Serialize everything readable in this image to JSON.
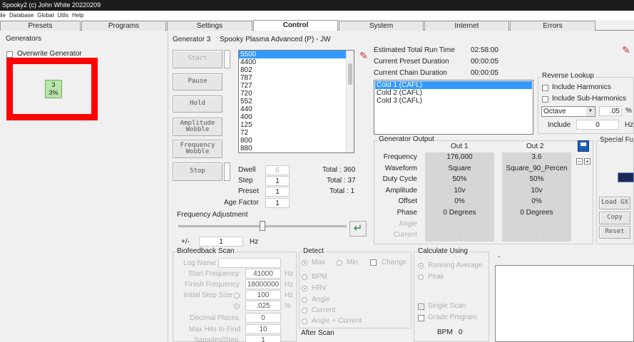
{
  "window": {
    "title": "Spooky2 (c) John White 20220209"
  },
  "menu": [
    "ile",
    "Database",
    "Global",
    "Utils",
    "Help"
  ],
  "tabs": [
    {
      "label": "Presets"
    },
    {
      "label": "Programs"
    },
    {
      "label": "Settings"
    },
    {
      "label": "Control"
    },
    {
      "label": "System"
    },
    {
      "label": "Internet"
    },
    {
      "label": "Errors"
    }
  ],
  "generators": {
    "heading": "Generators",
    "overwrite_label": "Overwrite Generator",
    "tile_number": "3",
    "tile_percent": "3%"
  },
  "control": {
    "gen_label": "Generator 3",
    "gen_program": "Spooky Plasma Advanced (P) - JW",
    "buttons": {
      "start": "Start",
      "pause": "Pause",
      "hold": "Hold",
      "amplitude_wobble": "Amplitude\nWobble",
      "frequency_wobble": "Frequency\nWobble",
      "stop": "Stop"
    },
    "freq_list": [
      "5500",
      "4400",
      "802",
      "787",
      "727",
      "720",
      "552",
      "440",
      "400",
      "125",
      "72",
      "800",
      "880"
    ],
    "dwell_label": "Dwell",
    "dwell_value": "6",
    "step_label": "Step",
    "step_value": "1",
    "preset_label": "Preset",
    "preset_value": "1",
    "age_label": "Age Factor",
    "age_value": "1",
    "total_dwell": "Total : 360",
    "total_step": "Total : 37",
    "total_preset": "Total : 1"
  },
  "run": {
    "estimated_label": "Estimated Total Run Time",
    "estimated_value": "02:58:00",
    "preset_label": "Current Preset Duration",
    "preset_value": "00:00:05",
    "chain_label": "Current Chain Duration",
    "chain_value": "00:00:05",
    "presets": [
      "Cold 1 (CAFL)",
      "Cold 2 (CAFL)",
      "Cold 3 (CAFL)"
    ]
  },
  "reverse_lookup": {
    "heading": "Reverse Lookup",
    "harmonics": "Include Harmonics",
    "sub_harmonics": "Include Sub-Harmonics",
    "mode": "Octave",
    "value": ".05",
    "percent": "%",
    "include_label": "Include",
    "include_value": "0",
    "hz_label": "Hz"
  },
  "special": {
    "heading": "Special Fu",
    "load": "Load GX",
    "copy": "Copy",
    "reset": "Reset"
  },
  "output": {
    "heading": "Generator Output",
    "col1": "Out 1",
    "col2": "Out 2",
    "rows": [
      {
        "label": "Frequency",
        "out1": "176,000",
        "out2": "3.6",
        "dim": false
      },
      {
        "label": "Waveform",
        "out1": "Square",
        "out2": "Square_90_Percen",
        "dim": false
      },
      {
        "label": "Duty Cycle",
        "out1": "50%",
        "out2": "50%",
        "dim": false
      },
      {
        "label": "Amplitude",
        "out1": "10v",
        "out2": "10v",
        "dim": false
      },
      {
        "label": "Offset",
        "out1": "0%",
        "out2": "0%",
        "dim": false
      },
      {
        "label": "Phase",
        "out1": "0 Degrees",
        "out2": "0 Degrees",
        "dim": false
      },
      {
        "label": "Angle",
        "out1": "-",
        "out2": "-",
        "dim": true
      },
      {
        "label": "Current",
        "out1": "-",
        "out2": "-",
        "dim": true
      }
    ]
  },
  "freq_adjust": {
    "heading": "Frequency Adjustment",
    "plusminus": "+/-",
    "value": "1",
    "unit": "Hz",
    "slider_level": 0.5
  },
  "biofeedback": {
    "heading": "Biofeedback Scan",
    "log_name": "Log Name",
    "start_label": "Start Frequency",
    "start_value": "41000",
    "start_unit": "Hz",
    "finish_label": "Finish Frequency",
    "finish_value": "18000000",
    "finish_unit": "Hz",
    "step_label": "Initial Step Size",
    "step_value": "100",
    "step_unit": "Hz",
    "step_pct_value": ".025",
    "step_pct_unit": "%",
    "decimal_label": "Decimal Places",
    "decimal_value": "0",
    "maxhits_label": "Max Hits to Find",
    "maxhits_value": "10",
    "samples_label": "Samples/Step",
    "samples_value": "1"
  },
  "detect": {
    "heading": "Detect",
    "max": "Max",
    "min": "Min",
    "change": "Change",
    "bpm": "BPM",
    "hrv": "HRV",
    "angle": "Angle",
    "current": "Current",
    "angle_current": "Angle + Current",
    "after_scan": "After Scan"
  },
  "calculate": {
    "heading": "Calculate Using",
    "running_average": "Running Average",
    "peak": "Peak",
    "single_scan": "Single Scan",
    "grade": "Grade Program",
    "bpm_label": "BPM",
    "bpm_value": "0"
  },
  "graph": {
    "dash": "-"
  },
  "colors": {
    "highlight": "#ff0000",
    "selection": "#3399ff",
    "tile": "#b7e6a8"
  }
}
